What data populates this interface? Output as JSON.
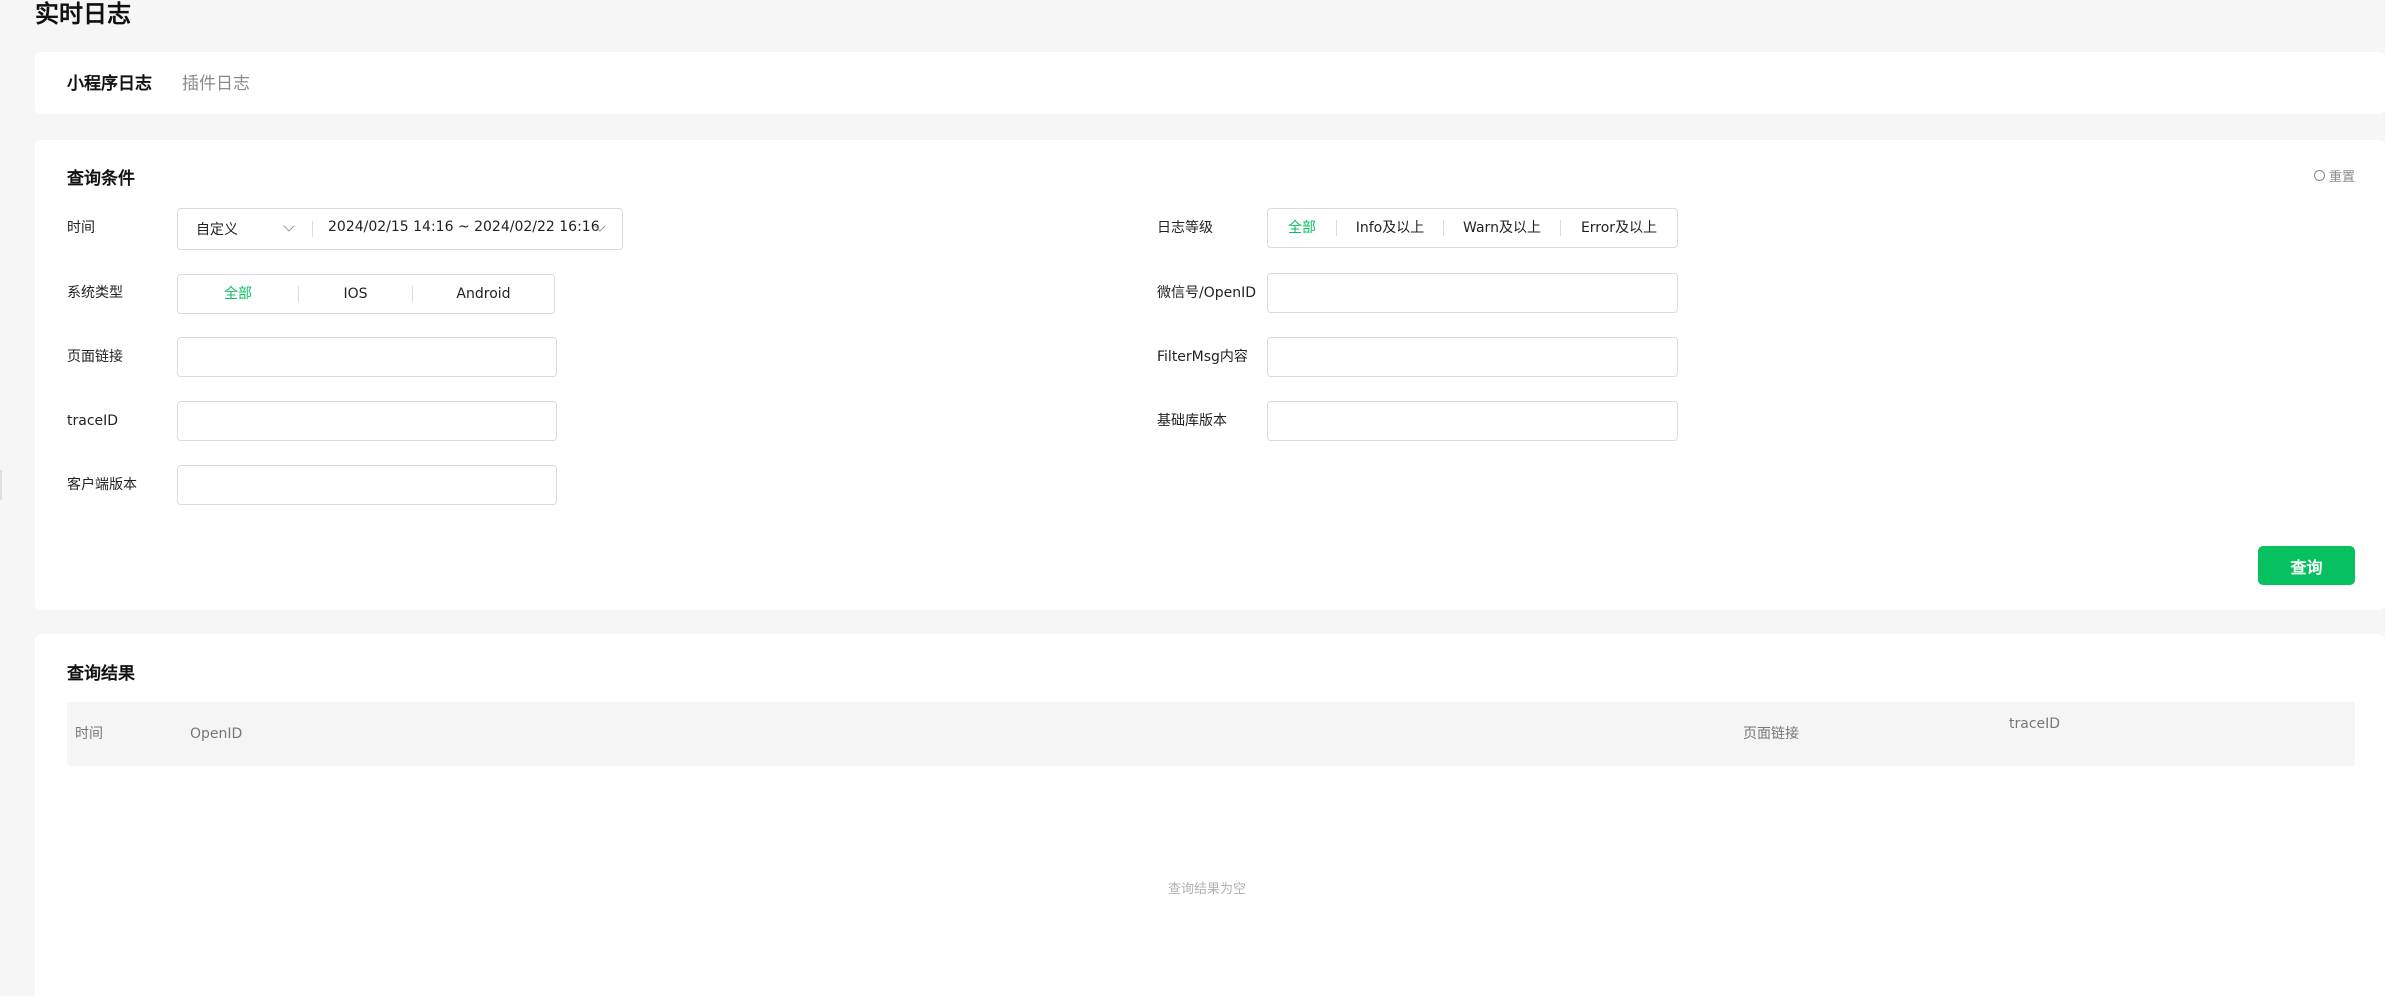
{
  "page": {
    "title": "实时日志"
  },
  "tabs": [
    {
      "label": "小程序日志",
      "active": true
    },
    {
      "label": "插件日志",
      "active": false
    }
  ],
  "query": {
    "title": "查询条件",
    "reset_label": "重置",
    "time": {
      "label": "时间",
      "preset": "自定义",
      "range": "2024/02/15 14:16 ~ 2024/02/22 16:16"
    },
    "log_level": {
      "label": "日志等级",
      "options": [
        "全部",
        "Info及以上",
        "Warn及以上",
        "Error及以上"
      ],
      "selected": "全部"
    },
    "os_type": {
      "label": "系统类型",
      "options": [
        "全部",
        "IOS",
        "Android"
      ],
      "selected": "全部"
    },
    "wechat_openid": {
      "label": "微信号/OpenID",
      "value": ""
    },
    "page_link": {
      "label": "页面链接",
      "value": ""
    },
    "filter_msg": {
      "label": "FilterMsg内容",
      "value": ""
    },
    "trace_id": {
      "label": "traceID",
      "value": ""
    },
    "lib_version": {
      "label": "基础库版本",
      "value": ""
    },
    "client_version": {
      "label": "客户端版本",
      "value": ""
    },
    "search_label": "查询"
  },
  "results": {
    "title": "查询结果",
    "columns": [
      "时间",
      "OpenID",
      "页面链接",
      "traceID"
    ],
    "rows": [],
    "empty_text": "查询结果为空"
  },
  "colors": {
    "accent": "#07c160",
    "background": "#f6f6f6"
  }
}
